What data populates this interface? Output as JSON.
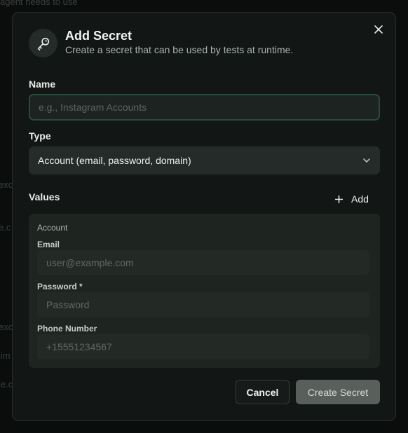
{
  "background": {
    "top_text": "agent needs to use",
    "fragments": [
      "exc",
      "e.c",
      "exc",
      "lim",
      "le.c"
    ]
  },
  "dialog": {
    "title": "Add Secret",
    "subtitle": "Create a secret that can be used by tests at runtime.",
    "header_icon": "key-icon",
    "close_icon": "close-icon"
  },
  "name_field": {
    "label": "Name",
    "value": "",
    "placeholder": "e.g., Instagram Accounts"
  },
  "type_field": {
    "label": "Type",
    "selected": "Account (email, password, domain)",
    "icon": "chevron-down-icon"
  },
  "values_section": {
    "label": "Values",
    "add_label": "Add",
    "panel_title": "Account",
    "fields": [
      {
        "label": "Email",
        "value": "",
        "placeholder": "user@example.com"
      },
      {
        "label": "Password *",
        "value": "",
        "placeholder": "Password"
      },
      {
        "label": "Phone Number",
        "value": "",
        "placeholder": "+15551234567"
      }
    ]
  },
  "actions": {
    "cancel_label": "Cancel",
    "create_label": "Create Secret"
  },
  "colors": {
    "modal_bg": "#121614",
    "input_focus_border": "#2a4a3b",
    "primary_disabled": "#59605c"
  }
}
